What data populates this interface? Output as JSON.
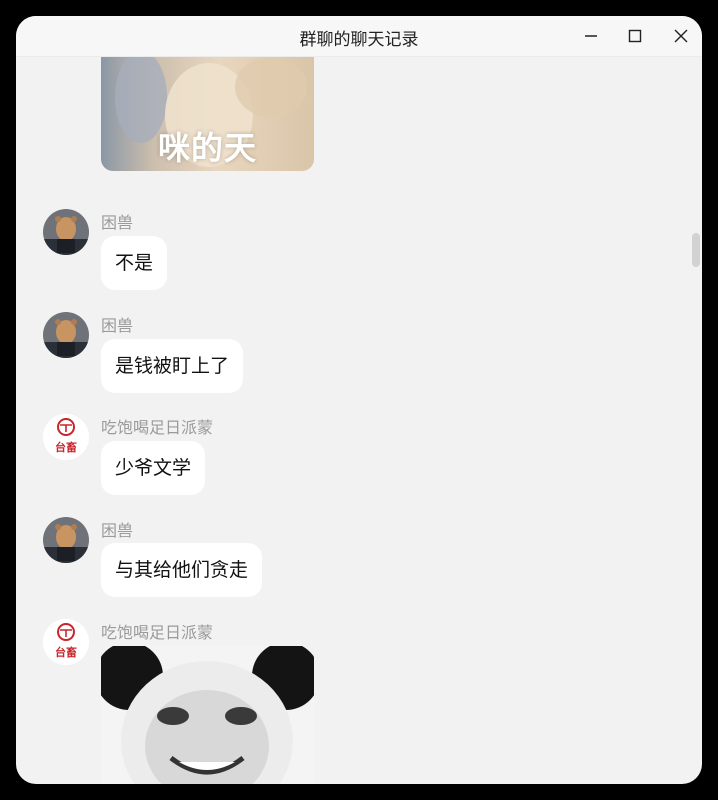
{
  "window": {
    "title": "群聊的聊天记录"
  },
  "colors": {
    "window_bg": "#f2f2f2",
    "bubble_bg": "#ffffff",
    "sender_text": "#9a9a9a",
    "logo_red": "#c8262c"
  },
  "messages": [
    {
      "type": "sticker",
      "caption": "咪的天"
    },
    {
      "sender": "困兽",
      "avatar": "bear-avatar",
      "text": "不是"
    },
    {
      "sender": "困兽",
      "avatar": "bear-avatar",
      "text": "是钱被盯上了"
    },
    {
      "sender": "吃饱喝足日派蒙",
      "avatar": "taichu-logo-avatar",
      "logo_text": "台畜",
      "text": "少爷文学"
    },
    {
      "sender": "困兽",
      "avatar": "bear-avatar",
      "text": "与其给他们贪走"
    },
    {
      "sender": "吃饱喝足日派蒙",
      "avatar": "taichu-logo-avatar",
      "logo_text": "台畜",
      "type": "sticker",
      "sticker": "panda-face"
    }
  ]
}
